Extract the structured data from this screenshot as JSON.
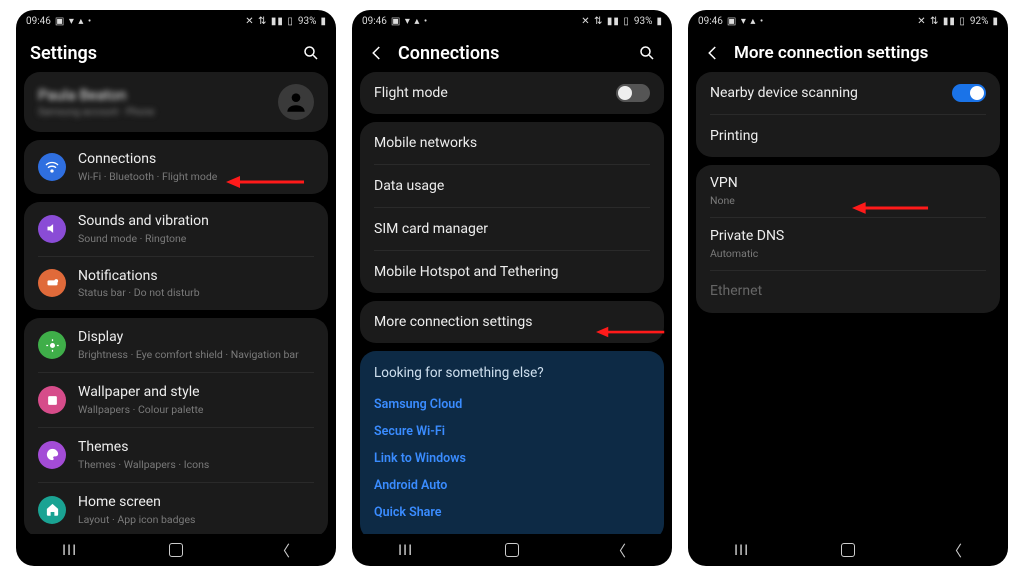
{
  "status": {
    "time": "09:46",
    "battery1": "93%",
    "battery3": "92%"
  },
  "s1": {
    "title": "Settings",
    "profile": {
      "name": "Paula Beaton",
      "sub": "Samsung account · Phone"
    },
    "connections": {
      "title": "Connections",
      "sub": "Wi-Fi · Bluetooth · Flight mode"
    },
    "sounds": {
      "title": "Sounds and vibration",
      "sub": "Sound mode · Ringtone"
    },
    "notifications": {
      "title": "Notifications",
      "sub": "Status bar · Do not disturb"
    },
    "display": {
      "title": "Display",
      "sub": "Brightness · Eye comfort shield · Navigation bar"
    },
    "wallpaper": {
      "title": "Wallpaper and style",
      "sub": "Wallpapers · Colour palette"
    },
    "themes": {
      "title": "Themes",
      "sub": "Themes · Wallpapers · Icons"
    },
    "homescreen": {
      "title": "Home screen",
      "sub": "Layout · App icon badges"
    }
  },
  "s2": {
    "title": "Connections",
    "flight": "Flight mode",
    "mobile_networks": "Mobile networks",
    "data_usage": "Data usage",
    "sim": "SIM card manager",
    "hotspot": "Mobile Hotspot and Tethering",
    "more": "More connection settings",
    "looking": "Looking for something else?",
    "links": {
      "samsung_cloud": "Samsung Cloud",
      "secure_wifi": "Secure Wi-Fi",
      "link_windows": "Link to Windows",
      "android_auto": "Android Auto",
      "quick_share": "Quick Share"
    }
  },
  "s3": {
    "title": "More connection settings",
    "nearby": "Nearby device scanning",
    "printing": "Printing",
    "vpn": {
      "title": "VPN",
      "sub": "None"
    },
    "private_dns": {
      "title": "Private DNS",
      "sub": "Automatic"
    },
    "ethernet": "Ethernet"
  }
}
